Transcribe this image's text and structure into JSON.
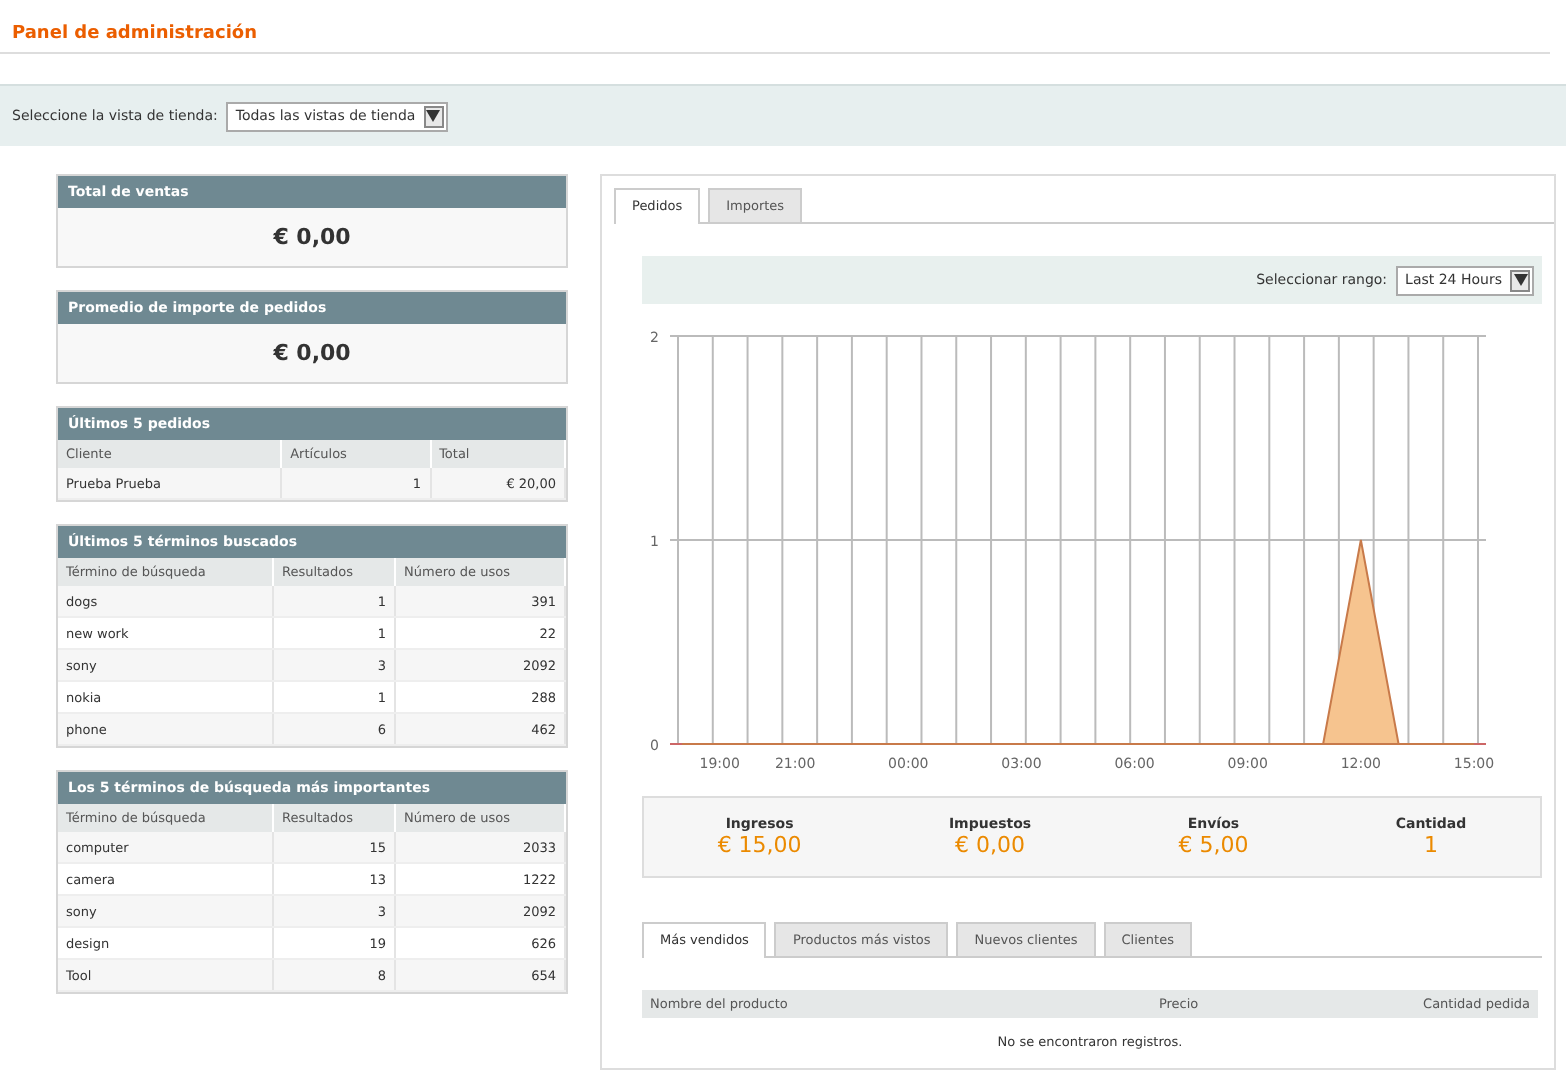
{
  "page_title": "Panel de administración",
  "store_switcher": {
    "label": "Seleccione la vista de tienda:",
    "value": "Todas las vistas de tienda"
  },
  "summary_boxes": [
    {
      "title": "Total de ventas",
      "value": "€ 0,00"
    },
    {
      "title": "Promedio de importe de pedidos",
      "value": "€ 0,00"
    }
  ],
  "grids": [
    {
      "title": "Últimos 5 pedidos",
      "columns": [
        "Cliente",
        "Artículos",
        "Total"
      ],
      "rows": [
        [
          "Prueba Prueba",
          "1",
          "€ 20,00"
        ]
      ]
    },
    {
      "title": "Últimos 5 términos buscados",
      "columns": [
        "Término de búsqueda",
        "Resultados",
        "Número de usos"
      ],
      "rows": [
        [
          "dogs",
          "1",
          "391"
        ],
        [
          "new work",
          "1",
          "22"
        ],
        [
          "sony",
          "3",
          "2092"
        ],
        [
          "nokia",
          "1",
          "288"
        ],
        [
          "phone",
          "6",
          "462"
        ]
      ]
    },
    {
      "title": "Los 5 términos de búsqueda más importantes",
      "columns": [
        "Término de búsqueda",
        "Resultados",
        "Número de usos"
      ],
      "rows": [
        [
          "computer",
          "15",
          "2033"
        ],
        [
          "camera",
          "13",
          "1222"
        ],
        [
          "sony",
          "3",
          "2092"
        ],
        [
          "design",
          "19",
          "626"
        ],
        [
          "Tool",
          "8",
          "654"
        ]
      ]
    }
  ],
  "chart_tabs": [
    {
      "label": "Pedidos",
      "selected": true
    },
    {
      "label": "Importes",
      "selected": false
    }
  ],
  "range": {
    "label": "Seleccionar rango:",
    "value": "Last 24 Hours"
  },
  "chart_data": {
    "type": "area",
    "grid": true,
    "categories": [
      null,
      "19:00",
      null,
      "21:00",
      null,
      null,
      "00:00",
      null,
      null,
      "03:00",
      null,
      null,
      "06:00",
      null,
      null,
      "09:00",
      null,
      null,
      "12:00",
      null,
      null,
      "15:00"
    ],
    "series": [
      {
        "color": "#f6c48f",
        "values": [
          0,
          0,
          0,
          0,
          0,
          0,
          0,
          0,
          0,
          0,
          0,
          0,
          0,
          0,
          0,
          0,
          0,
          0,
          1,
          0,
          0,
          0
        ]
      }
    ],
    "ylim": [
      0,
      2
    ],
    "yticks": [
      0,
      1,
      2
    ]
  },
  "totals": [
    {
      "label": "Ingresos",
      "value": "€ 15,00"
    },
    {
      "label": "Impuestos",
      "value": "€ 0,00"
    },
    {
      "label": "Envíos",
      "value": "€ 5,00"
    },
    {
      "label": "Cantidad",
      "value": "1"
    }
  ],
  "bottom_tabs": [
    {
      "label": "Más vendidos",
      "selected": true
    },
    {
      "label": "Productos más vistos",
      "selected": false
    },
    {
      "label": "Nuevos clientes",
      "selected": false
    },
    {
      "label": "Clientes",
      "selected": false
    }
  ],
  "products_table": {
    "columns": [
      "Nombre del producto",
      "Precio",
      "Cantidad pedida"
    ],
    "empty_message": "No se encontraron registros."
  }
}
